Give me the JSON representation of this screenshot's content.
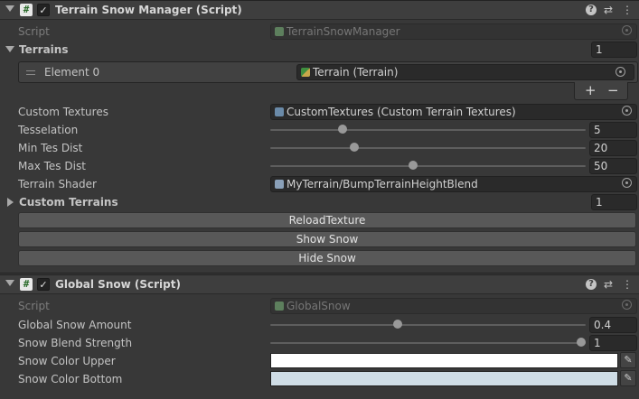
{
  "components": [
    {
      "title": "Terrain Snow Manager (Script)",
      "enabled_check": "✓",
      "script_label": "Script",
      "script_value": "TerrainSnowManager",
      "terrains": {
        "label": "Terrains",
        "count": "1",
        "element_label": "Element 0",
        "element_value": "Terrain (Terrain)",
        "add": "+",
        "remove": "−"
      },
      "custom_textures": {
        "label": "Custom Textures",
        "value": "CustomTextures (Custom Terrain Textures)"
      },
      "tesselation": {
        "label": "Tesselation",
        "value": "5",
        "fraction": 0.22
      },
      "min_tes_dist": {
        "label": "Min Tes Dist",
        "value": "20",
        "fraction": 0.26
      },
      "max_tes_dist": {
        "label": "Max Tes Dist",
        "value": "50",
        "fraction": 0.45
      },
      "terrain_shader": {
        "label": "Terrain Shader",
        "value": "MyTerrain/BumpTerrainHeightBlend"
      },
      "custom_terrains": {
        "label": "Custom Terrains",
        "count": "1"
      },
      "buttons": {
        "reload": "ReloadTexture",
        "show": "Show Snow",
        "hide": "Hide Snow"
      }
    },
    {
      "title": "Global Snow (Script)",
      "enabled_check": "✓",
      "script_label": "Script",
      "script_value": "GlobalSnow",
      "global_snow_amount": {
        "label": "Global Snow Amount",
        "value": "0.4",
        "fraction": 0.4
      },
      "snow_blend_strength": {
        "label": "Snow Blend Strength",
        "value": "1",
        "fraction": 1.0
      },
      "snow_color_upper": {
        "label": "Snow Color Upper",
        "color": "#ffffff"
      },
      "snow_color_bottom": {
        "label": "Snow Color Bottom",
        "color": "#cfdde6"
      }
    }
  ],
  "icons": {
    "help": "?",
    "settings": "⇄",
    "menu": "⋮",
    "eyedropper": "✎",
    "script": "#"
  }
}
